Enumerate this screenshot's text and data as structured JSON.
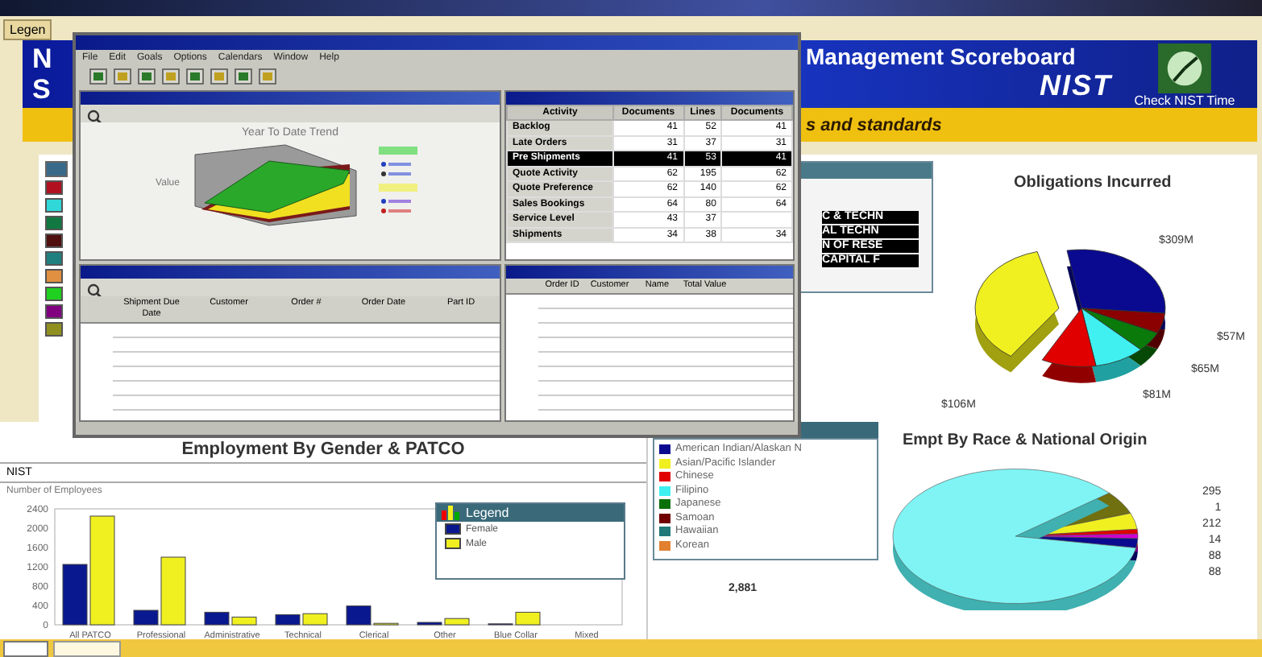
{
  "legend_tab": "Legen",
  "header": {
    "fragments": [
      "N",
      "S"
    ],
    "title": "Management Scoreboard",
    "logo": "NIST",
    "link": "Check NIST Time",
    "tagline": "s and standards"
  },
  "color_legend": [
    {
      "color": "#b01020"
    },
    {
      "color": "#30d8d8"
    },
    {
      "color": "#107840"
    },
    {
      "color": "#501010"
    },
    {
      "color": "#208080"
    },
    {
      "color": "#e09040"
    },
    {
      "color": "#20d020"
    },
    {
      "color": "#800080"
    },
    {
      "color": "#909020"
    }
  ],
  "org_list": {
    "items": [
      {
        "label": "C & TECHN"
      },
      {
        "label": "AL TECHN"
      },
      {
        "label": "N OF RESE"
      },
      {
        "label": "CAPITAL F"
      }
    ]
  },
  "obligations": {
    "title": "Obligations Incurred",
    "labels": [
      "$309M",
      "$57M",
      "$65M",
      "$81M",
      "$106M"
    ]
  },
  "app_window": {
    "menu": [
      "File",
      "Edit",
      "Goals",
      "Options",
      "Calendars",
      "Window",
      "Help"
    ],
    "graph_panel": {
      "title": "Year To Date Trend",
      "ylabel": "Value"
    },
    "activity_table": {
      "columns": [
        "Activity",
        "Documents",
        "Lines",
        "Documents"
      ],
      "rows": [
        {
          "cells": [
            "Backlog",
            "41",
            "52",
            "41"
          ],
          "selected": false
        },
        {
          "cells": [
            "Late Orders",
            "31",
            "37",
            "31"
          ],
          "selected": false
        },
        {
          "cells": [
            "Pre Shipments",
            "41",
            "53",
            "41"
          ],
          "selected": true
        },
        {
          "cells": [
            "Quote Activity",
            "62",
            "195",
            "62"
          ],
          "selected": false
        },
        {
          "cells": [
            "Quote Preference",
            "62",
            "140",
            "62"
          ],
          "selected": false
        },
        {
          "cells": [
            "Sales Bookings",
            "64",
            "80",
            "64"
          ],
          "selected": false
        },
        {
          "cells": [
            "Service Level",
            "43",
            "37",
            ""
          ],
          "selected": false
        },
        {
          "cells": [
            "Shipments",
            "34",
            "38",
            "34"
          ],
          "selected": false
        }
      ]
    },
    "order_grid": {
      "columns": [
        "Shipment Due Date",
        "Customer",
        "Order #",
        "Order Date",
        "Part ID"
      ]
    },
    "value_grid": {
      "columns": [
        "Order ID",
        "Customer",
        "Name",
        "Total Value"
      ]
    }
  },
  "employment": {
    "title": "Employment By Gender & PATCO",
    "subtitle": "NIST",
    "legend_title": "Legend",
    "chart_data": {
      "type": "bar",
      "ylabel": "Number of Employees",
      "categories": [
        "All PATCO",
        "Professional",
        "Administrative",
        "Technical",
        "Clerical",
        "Other",
        "Blue Collar",
        "Mixed"
      ],
      "series": [
        {
          "name": "Female",
          "color": "#0a1890",
          "values": [
            1250,
            300,
            260,
            210,
            390,
            50,
            20,
            0
          ]
        },
        {
          "name": "Male",
          "color": "#f0f020",
          "values": [
            2250,
            1400,
            160,
            230,
            30,
            130,
            260,
            0
          ]
        }
      ],
      "legend": true,
      "ylim": [
        0,
        2400
      ],
      "yticks": [
        0,
        400,
        800,
        1200,
        1600,
        2000,
        2400
      ]
    }
  },
  "race_legend": [
    {
      "label": "American Indian/Alaskan N",
      "color": "#0a0a90"
    },
    {
      "label": "Asian/Pacific Islander",
      "color": "#f0f020"
    },
    {
      "label": "Chinese",
      "color": "#e00000"
    },
    {
      "label": "Filipino",
      "color": "#40f0f0"
    },
    {
      "label": "Japanese",
      "color": "#0a700a"
    },
    {
      "label": "Samoan",
      "color": "#700000"
    },
    {
      "label": "Hawaiian",
      "color": "#207878"
    },
    {
      "label": "Korean",
      "color": "#e08030"
    }
  ],
  "race_chart": {
    "title": "Empt By Race & National Origin",
    "labels": [
      "295",
      "1",
      "212",
      "14",
      "88",
      "88"
    ],
    "main_label": "2,881"
  }
}
